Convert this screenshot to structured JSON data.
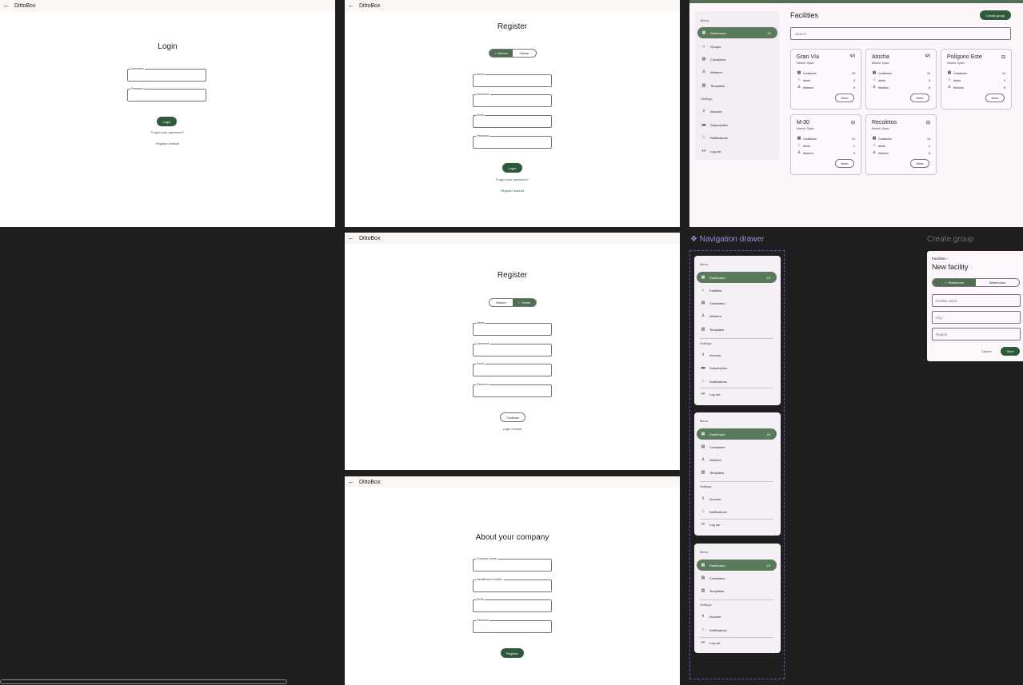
{
  "app_name": "DittoBox",
  "login": {
    "title": "Login",
    "username_label": "Username",
    "password_label": "Password",
    "login_button": "Login",
    "forgot": "Forgot your password?",
    "register_instead": "Register instead"
  },
  "register_worker": {
    "title": "Register",
    "seg_worker": "Worker",
    "seg_owner": "Owner",
    "name_label": "Name",
    "username_label": "Username",
    "email_label": "Email",
    "password_label": "Password",
    "login_button": "Login",
    "forgot": "Forgot your password?",
    "register_instead": "Register instead"
  },
  "register_owner": {
    "title": "Register",
    "seg_worker": "Worker",
    "seg_owner": "Owner",
    "name_label": "Name",
    "username_label": "Username",
    "email_label": "Email",
    "password_label": "Password",
    "continue_button": "Continue",
    "login_instead": "Login instead"
  },
  "company": {
    "title": "About your company",
    "company_label": "Company name",
    "id_label": "Identification number",
    "email_label": "Email",
    "password_label": "Password",
    "register_button": "Register"
  },
  "dashboard": {
    "menu_label": "Menu",
    "settings_label": "Settings",
    "menu_items": [
      {
        "label": "Dashboard",
        "badge": "24",
        "icon": "dashboard-icon"
      },
      {
        "label": "Groups",
        "icon": "groups-icon"
      },
      {
        "label": "Containers",
        "icon": "containers-icon"
      },
      {
        "label": "Workers",
        "icon": "workers-icon"
      },
      {
        "label": "Templates",
        "icon": "templates-icon"
      }
    ],
    "settings_items": [
      {
        "label": "Account",
        "icon": "account-icon"
      },
      {
        "label": "Subscription",
        "icon": "subscription-icon"
      },
      {
        "label": "Notifications",
        "icon": "notifications-icon"
      },
      {
        "label": "Log out",
        "icon": "logout-icon"
      }
    ],
    "title": "Facilities",
    "create_button": "Create group",
    "search_placeholder": "Search",
    "cards": [
      {
        "name": "Gran Vía",
        "city": "Madrid, Spain",
        "icon": "restaurant-icon",
        "containers": "24",
        "alerts": "3",
        "workers": "8",
        "more": "More"
      },
      {
        "name": "Atocha",
        "city": "Madrid, Spain",
        "icon": "restaurant-icon",
        "containers": "24",
        "alerts": "3",
        "workers": "8",
        "more": "More"
      },
      {
        "name": "Polígono Este",
        "city": "Madrid, Spain",
        "icon": "warehouse-icon",
        "containers": "24",
        "alerts": "3",
        "workers": "8",
        "more": "More"
      },
      {
        "name": "M-30",
        "city": "Madrid, Spain",
        "icon": "warehouse-icon",
        "containers": "24",
        "alerts": "1",
        "workers": "8",
        "more": "More"
      },
      {
        "name": "Recoletos",
        "city": "Madrid, Spain",
        "icon": "warehouse-icon",
        "containers": "24",
        "alerts": "2",
        "workers": "8",
        "more": "More"
      }
    ],
    "row_labels": {
      "containers": "Containers",
      "alerts": "Alerts",
      "workers": "Workers"
    }
  },
  "nav_drawer_section": {
    "title": "❖ Navigation drawer"
  },
  "drawer1": {
    "menu_label": "Menu",
    "settings_label": "Settings",
    "items": [
      "Dashboard",
      "Facilities",
      "Containers",
      "Workers",
      "Templates"
    ],
    "badge": "24",
    "settings": [
      "Account",
      "Subscription",
      "Notifications",
      "Log out"
    ]
  },
  "drawer2": {
    "menu_label": "Menu",
    "settings_label": "Settings",
    "items": [
      "Dashboard",
      "Containers",
      "Workers",
      "Templates"
    ],
    "badge": "24",
    "settings": [
      "Account",
      "Notifications",
      "Log out"
    ]
  },
  "drawer3": {
    "menu_label": "Menu",
    "settings_label": "Settings",
    "items": [
      "Dashboard",
      "Containers",
      "Templates"
    ],
    "badge": "24",
    "settings": [
      "Account",
      "Notifications",
      "Log out"
    ]
  },
  "create_group": {
    "section_title": "Create group",
    "breadcrumb": "Facilities",
    "title": "New facility",
    "seg_restaurant": "Restaurant",
    "seg_warehouse": "Warehouse",
    "name_ph": "Facility name",
    "city_ph": "City",
    "region_ph": "Region",
    "cancel": "Cancel",
    "save": "Save"
  }
}
